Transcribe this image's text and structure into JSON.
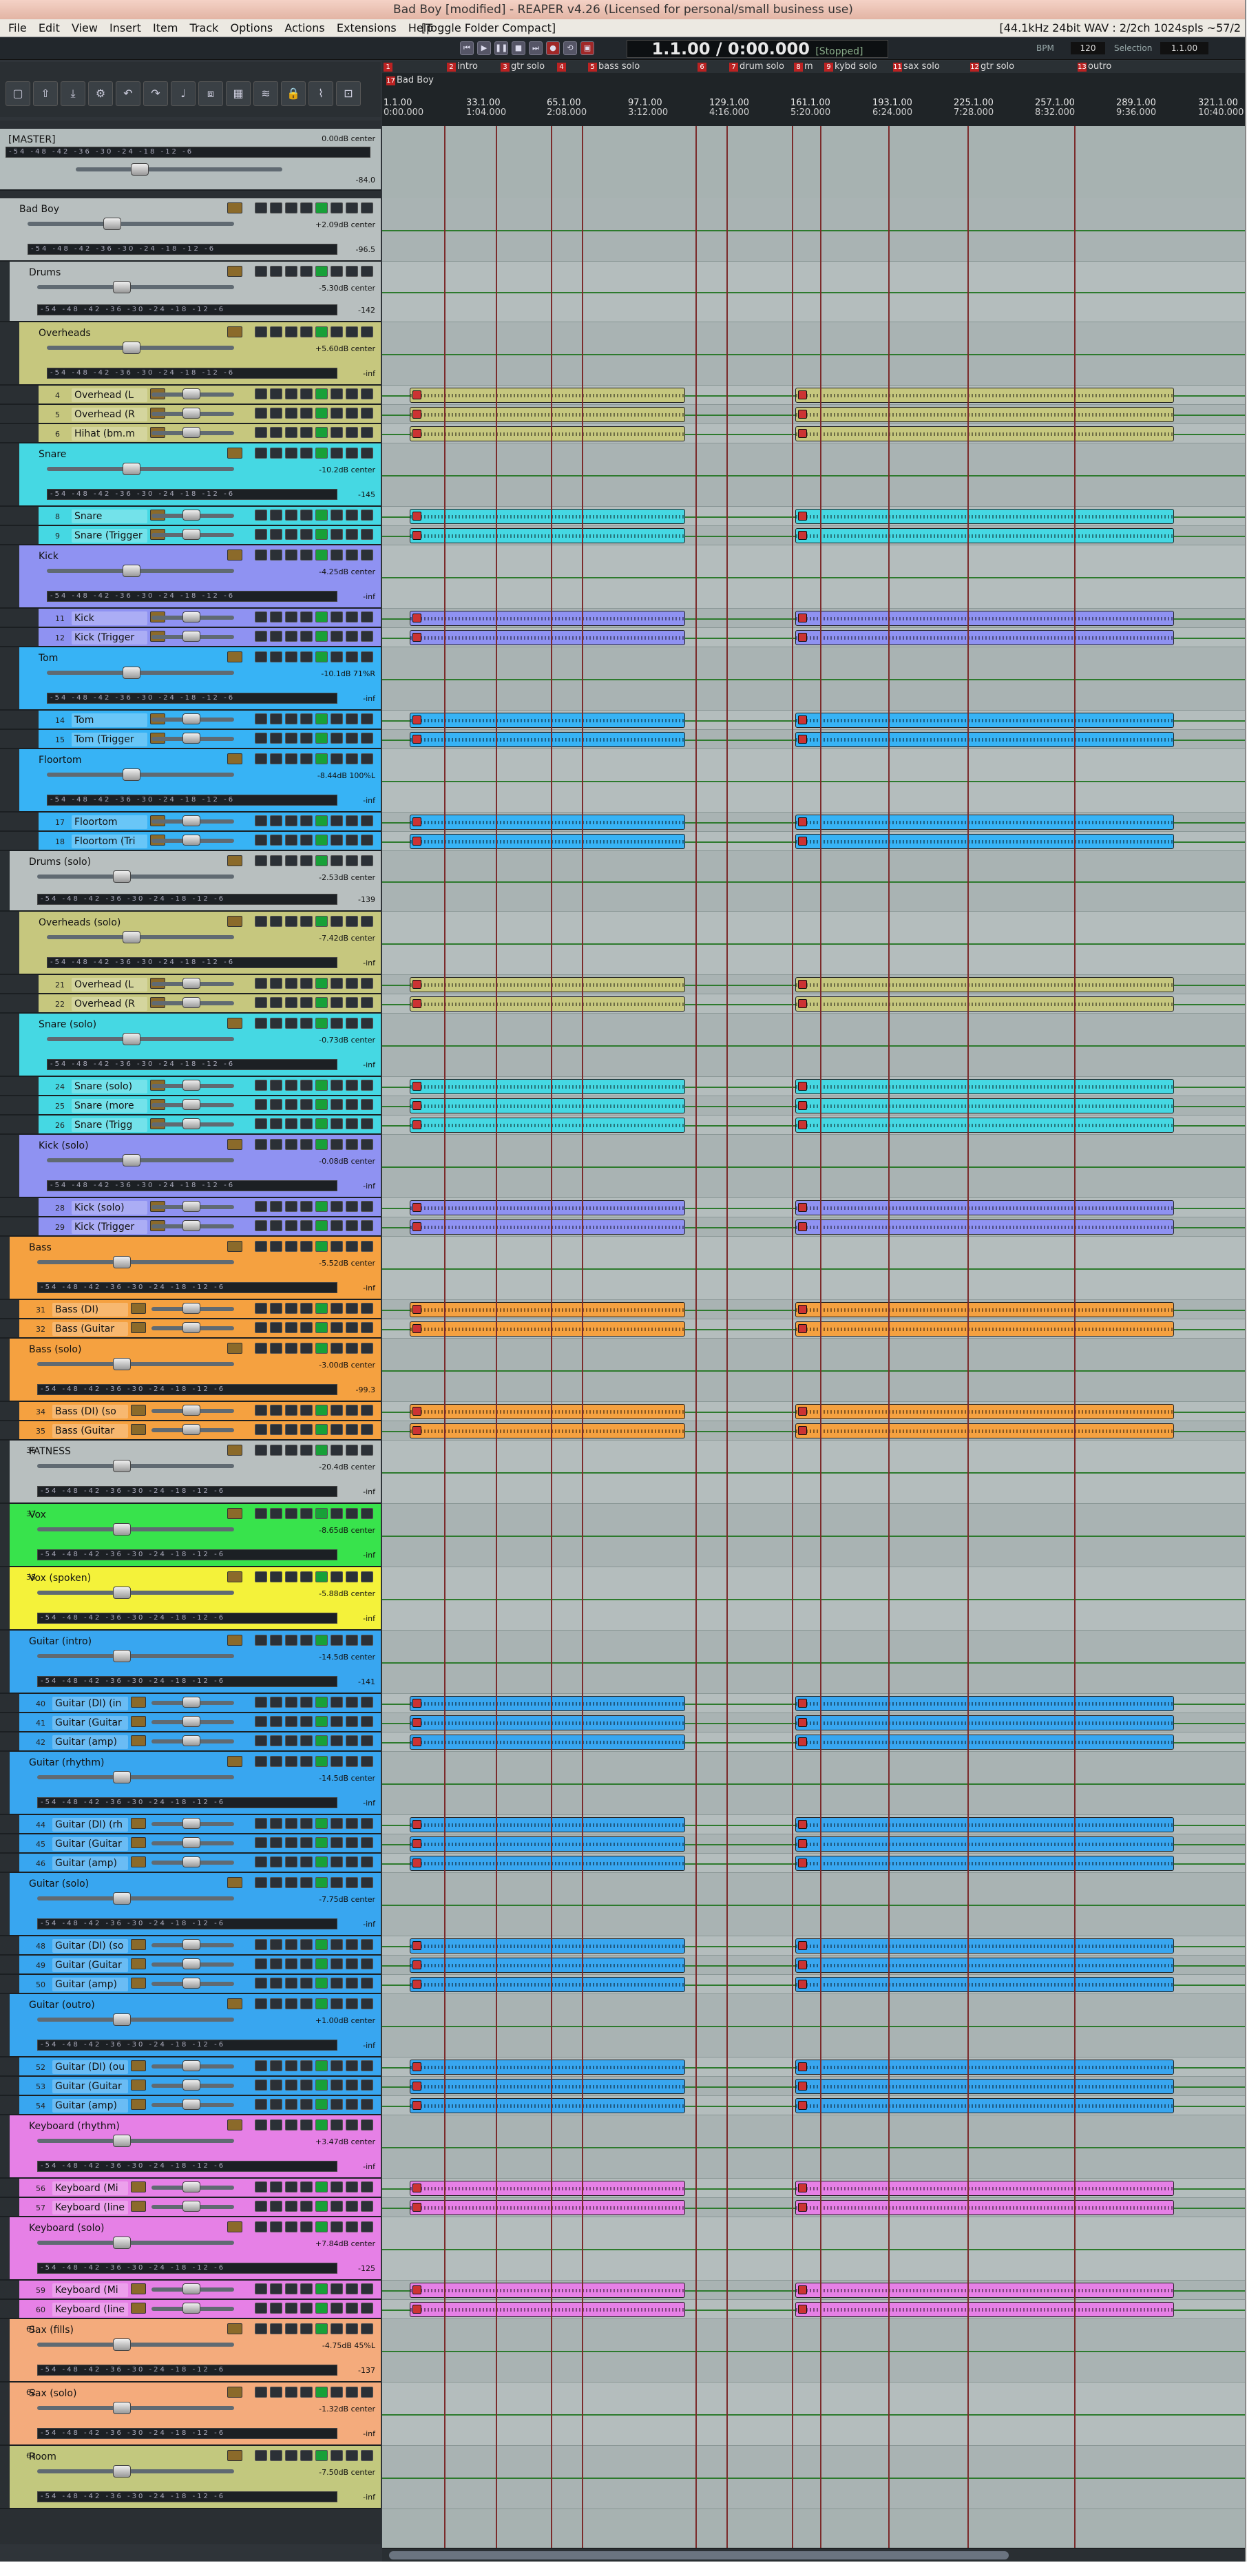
{
  "window": {
    "title": "Bad Boy [modified] - REAPER v4.26 (Licensed for personal/small business use)"
  },
  "menu": {
    "items": [
      "File",
      "Edit",
      "View",
      "Insert",
      "Item",
      "Track",
      "Options",
      "Actions",
      "Extensions",
      "Help"
    ],
    "toggle": "[Toggle Folder Compact]",
    "info": "[44.1kHz 24bit WAV : 2/2ch 1024spls ~57/2"
  },
  "transport": {
    "time": "1.1.00 / 0:00.000",
    "status": "[Stopped]",
    "bpm_label": "BPM",
    "bpm": "120",
    "selection_label": "Selection",
    "selection": "1.1.00"
  },
  "project": {
    "label": "Bad Boy",
    "marker_number": "17"
  },
  "regions": [
    {
      "n": "1",
      "label": ""
    },
    {
      "n": "2",
      "label": "intro"
    },
    {
      "n": "3",
      "label": "gtr solo"
    },
    {
      "n": "4",
      "label": ""
    },
    {
      "n": "5",
      "label": "bass solo"
    },
    {
      "n": "6",
      "label": ""
    },
    {
      "n": "7",
      "label": "drum solo"
    },
    {
      "n": "8",
      "label": "m"
    },
    {
      "n": "9",
      "label": "kybd solo"
    },
    {
      "n": "11",
      "label": "sax solo"
    },
    {
      "n": "12",
      "label": "gtr solo"
    },
    {
      "n": "13",
      "label": "outro"
    }
  ],
  "ruler": [
    {
      "bar": "1.1.00",
      "time": "0:00.000"
    },
    {
      "bar": "33.1.00",
      "time": "1:04.000"
    },
    {
      "bar": "65.1.00",
      "time": "2:08.000"
    },
    {
      "bar": "97.1.00",
      "time": "3:12.000"
    },
    {
      "bar": "129.1.00",
      "time": "4:16.000"
    },
    {
      "bar": "161.1.00",
      "time": "5:20.000"
    },
    {
      "bar": "193.1.00",
      "time": "6:24.000"
    },
    {
      "bar": "225.1.00",
      "time": "7:28.000"
    },
    {
      "bar": "257.1.00",
      "time": "8:32.000"
    },
    {
      "bar": "289.1.00",
      "time": "9:36.000"
    },
    {
      "bar": "321.1.00",
      "time": "10:40.000"
    }
  ],
  "meter_scale": "-54 -48 -42 -36 -30 -24 -18 -12 -6",
  "master": {
    "name": "[MASTER]",
    "volume": "0.00dB center",
    "peak": "-84.0"
  },
  "colors": {
    "track_gray": "#b8bfbf",
    "olive": "#c6c77e",
    "cyan": "#45d8e3",
    "violet": "#8f92f2",
    "sky": "#37b3f5",
    "orange": "#f5a140",
    "green": "#38e34c",
    "yellow": "#f4f23a",
    "blue": "#38a6f0",
    "pink": "#e680e6",
    "salmon": "#f4ab7c",
    "khaki": "#c2c87e"
  },
  "tracks": [
    {
      "num": "",
      "name": "Bad Boy",
      "vol": "+2.09dB center",
      "peak": "-96.5"
    },
    {
      "num": "",
      "name": "Drums",
      "vol": "-5.30dB center",
      "peak": "-142"
    },
    {
      "num": "",
      "name": "Overheads",
      "vol": "+5.60dB center",
      "peak": "-inf"
    },
    {
      "num": "4",
      "name": "Overhead (L",
      "vol": "",
      "peak": ""
    },
    {
      "num": "5",
      "name": "Overhead (R",
      "vol": "",
      "peak": ""
    },
    {
      "num": "6",
      "name": "Hihat (bm.m",
      "vol": "",
      "peak": ""
    },
    {
      "num": "",
      "name": "Snare",
      "vol": "-10.2dB center",
      "peak": "-145"
    },
    {
      "num": "8",
      "name": "Snare",
      "vol": "",
      "peak": ""
    },
    {
      "num": "9",
      "name": "Snare (Trigger",
      "vol": "",
      "peak": ""
    },
    {
      "num": "",
      "name": "Kick",
      "vol": "-4.25dB center",
      "peak": "-inf"
    },
    {
      "num": "11",
      "name": "Kick",
      "vol": "",
      "peak": ""
    },
    {
      "num": "12",
      "name": "Kick (Trigger",
      "vol": "",
      "peak": ""
    },
    {
      "num": "",
      "name": "Tom",
      "vol": "-10.1dB 71%R",
      "peak": "-inf"
    },
    {
      "num": "14",
      "name": "Tom",
      "vol": "",
      "peak": ""
    },
    {
      "num": "15",
      "name": "Tom (Trigger",
      "vol": "",
      "peak": ""
    },
    {
      "num": "",
      "name": "Floortom",
      "vol": "-8.44dB 100%L",
      "peak": "-inf"
    },
    {
      "num": "17",
      "name": "Floortom",
      "vol": "",
      "peak": ""
    },
    {
      "num": "18",
      "name": "Floortom (Tri",
      "vol": "",
      "peak": ""
    },
    {
      "num": "",
      "name": "Drums (solo)",
      "vol": "-2.53dB center",
      "peak": "-139"
    },
    {
      "num": "",
      "name": "Overheads (solo)",
      "vol": "-7.42dB center",
      "peak": "-inf"
    },
    {
      "num": "21",
      "name": "Overhead (L",
      "vol": "",
      "peak": ""
    },
    {
      "num": "22",
      "name": "Overhead (R",
      "vol": "",
      "peak": ""
    },
    {
      "num": "",
      "name": "Snare (solo)",
      "vol": "-0.73dB center",
      "peak": "-inf"
    },
    {
      "num": "24",
      "name": "Snare (solo)",
      "vol": "",
      "peak": ""
    },
    {
      "num": "25",
      "name": "Snare (more",
      "vol": "",
      "peak": ""
    },
    {
      "num": "26",
      "name": "Snare (Trigg",
      "vol": "",
      "peak": ""
    },
    {
      "num": "",
      "name": "Kick (solo)",
      "vol": "-0.08dB center",
      "peak": "-inf"
    },
    {
      "num": "28",
      "name": "Kick (solo)",
      "vol": "",
      "peak": ""
    },
    {
      "num": "29",
      "name": "Kick (Trigger",
      "vol": "",
      "peak": ""
    },
    {
      "num": "",
      "name": "Bass",
      "vol": "-5.52dB center",
      "peak": "-inf"
    },
    {
      "num": "31",
      "name": "Bass (DI)",
      "vol": "",
      "peak": ""
    },
    {
      "num": "32",
      "name": "Bass (Guitar",
      "vol": "",
      "peak": ""
    },
    {
      "num": "",
      "name": "Bass (solo)",
      "vol": "-3.00dB center",
      "peak": "-99.3"
    },
    {
      "num": "34",
      "name": "Bass (DI) (so",
      "vol": "",
      "peak": ""
    },
    {
      "num": "35",
      "name": "Bass (Guitar",
      "vol": "",
      "peak": ""
    },
    {
      "num": "36",
      "name": "FATNESS",
      "vol": "-20.4dB center",
      "peak": "-inf"
    },
    {
      "num": "37",
      "name": "Vox",
      "vol": "-8.65dB center",
      "peak": "-inf"
    },
    {
      "num": "38",
      "name": "Vox (spoken)",
      "vol": "-5.88dB center",
      "peak": "-inf"
    },
    {
      "num": "",
      "name": "Guitar (intro)",
      "vol": "-14.5dB center",
      "peak": "-141"
    },
    {
      "num": "40",
      "name": "Guitar (DI) (in",
      "vol": "",
      "peak": ""
    },
    {
      "num": "41",
      "name": "Guitar (Guitar",
      "vol": "",
      "peak": ""
    },
    {
      "num": "42",
      "name": "Guitar (amp)",
      "vol": "",
      "peak": ""
    },
    {
      "num": "",
      "name": "Guitar (rhythm)",
      "vol": "-14.5dB center",
      "peak": "-inf"
    },
    {
      "num": "44",
      "name": "Guitar (DI) (rh",
      "vol": "",
      "peak": ""
    },
    {
      "num": "45",
      "name": "Guitar (Guitar",
      "vol": "",
      "peak": ""
    },
    {
      "num": "46",
      "name": "Guitar (amp)",
      "vol": "",
      "peak": ""
    },
    {
      "num": "",
      "name": "Guitar (solo)",
      "vol": "-7.75dB center",
      "peak": "-inf"
    },
    {
      "num": "48",
      "name": "Guitar (DI) (so",
      "vol": "",
      "peak": ""
    },
    {
      "num": "49",
      "name": "Guitar (Guitar",
      "vol": "",
      "peak": ""
    },
    {
      "num": "50",
      "name": "Guitar (amp)",
      "vol": "",
      "peak": ""
    },
    {
      "num": "",
      "name": "Guitar (outro)",
      "vol": "+1.00dB center",
      "peak": "-inf"
    },
    {
      "num": "52",
      "name": "Guitar (DI) (ou",
      "vol": "",
      "peak": ""
    },
    {
      "num": "53",
      "name": "Guitar (Guitar",
      "vol": "",
      "peak": ""
    },
    {
      "num": "54",
      "name": "Guitar (amp)",
      "vol": "",
      "peak": ""
    },
    {
      "num": "",
      "name": "Keyboard (rhythm)",
      "vol": "+3.47dB center",
      "peak": "-inf"
    },
    {
      "num": "56",
      "name": "Keyboard (Mi",
      "vol": "",
      "peak": ""
    },
    {
      "num": "57",
      "name": "Keyboard (line",
      "vol": "",
      "peak": ""
    },
    {
      "num": "",
      "name": "Keyboard (solo)",
      "vol": "+7.84dB center",
      "peak": "-125"
    },
    {
      "num": "59",
      "name": "Keyboard (Mi",
      "vol": "",
      "peak": ""
    },
    {
      "num": "60",
      "name": "Keyboard (line",
      "vol": "",
      "peak": ""
    },
    {
      "num": "61",
      "name": "Sax (fills)",
      "vol": "-4.75dB 45%L",
      "peak": "-137"
    },
    {
      "num": "62",
      "name": "Sax (solo)",
      "vol": "-1.32dB center",
      "peak": "-inf"
    },
    {
      "num": "63",
      "name": "Room",
      "vol": "-7.50dB center",
      "peak": "-inf"
    }
  ],
  "icons": {
    "toolbar": [
      "new-project-icon",
      "open-icon",
      "save-icon",
      "settings-icon",
      "undo-icon",
      "redo-icon",
      "metronome-icon",
      "snap-icon",
      "grid-icon",
      "ripple-icon",
      "lock-icon",
      "envelope-icon",
      "locking-icon"
    ],
    "transport": [
      "go-start-icon",
      "play-icon",
      "pause-icon",
      "stop-icon",
      "go-end-icon",
      "record-icon",
      "loop-icon"
    ]
  }
}
